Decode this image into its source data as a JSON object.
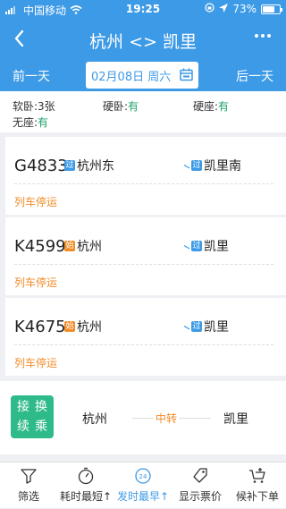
{
  "status": {
    "carrier": "中国移动",
    "time": "19:25",
    "battery": "73%",
    "battery_level": 0.73
  },
  "nav": {
    "title": "杭州 <> 凯里"
  },
  "date": {
    "prev": "前一天",
    "current": "02月08日 周六",
    "next": "后一天"
  },
  "seats": [
    {
      "label": "软卧:",
      "value": "3张"
    },
    {
      "label": "硬卧:",
      "value": "有"
    },
    {
      "label": "硬座:",
      "value": "有"
    },
    {
      "label": "无座:",
      "value": "有"
    }
  ],
  "trains": [
    {
      "code": "G4833",
      "from_tag": "过",
      "from": "杭州东",
      "to_tag": "过",
      "to": "凯里南",
      "status": "列车停运"
    },
    {
      "code": "K4599",
      "from_tag": "始",
      "from": "杭州",
      "to_tag": "过",
      "to": "凯里",
      "status": "列车停运"
    },
    {
      "code": "K4675",
      "from_tag": "始",
      "from": "杭州",
      "to_tag": "过",
      "to": "凯里",
      "status": "列车停运"
    }
  ],
  "transfer": {
    "badge_line1": "接换",
    "badge_line2": "续乘",
    "from": "杭州",
    "middle": "中转",
    "to": "凯里"
  },
  "tabs": [
    {
      "label": "筛选",
      "icon": "filter-icon"
    },
    {
      "label": "耗时最短",
      "icon": "timer-icon"
    },
    {
      "label": "发时最早",
      "icon": "clock-24-icon"
    },
    {
      "label": "显示票价",
      "icon": "price-tag-icon"
    },
    {
      "label": "候补下单",
      "icon": "cart-add-icon"
    }
  ],
  "colors": {
    "primary": "#3d9ae6",
    "accent": "#f28c28",
    "green": "#20a36b",
    "badge": "#2fba8a"
  }
}
